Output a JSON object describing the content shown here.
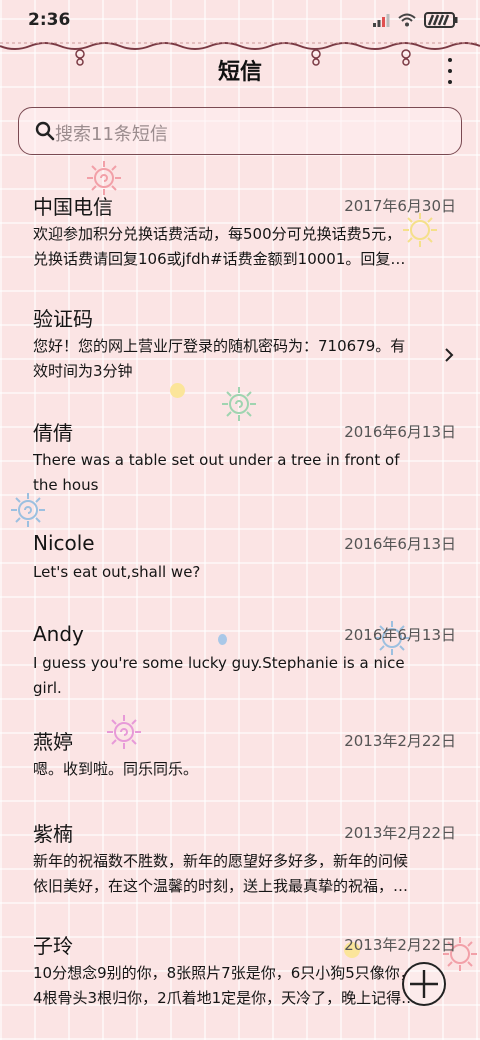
{
  "status": {
    "time": "2:36"
  },
  "header": {
    "title": "短信"
  },
  "search": {
    "placeholder": "搜索11条短信"
  },
  "messages": [
    {
      "sender": "中国电信",
      "date": "2017年6月30日",
      "lines": [
        "欢迎参加积分兑换话费活动，每500分可兑换话费5元，",
        "兑换话费请回复106或jfdh#话费金额到10001。回复…"
      ]
    },
    {
      "sender": "验证码",
      "date": "",
      "lines": [
        "您好！您的网上营业厅登录的随机密码为：710679。有",
        "效时间为3分钟"
      ]
    },
    {
      "sender": "倩倩",
      "date": "2016年6月13日",
      "lines": [
        "There was a table set out under a tree in front of",
        "the hous"
      ]
    },
    {
      "sender": "Nicole",
      "date": "2016年6月13日",
      "lines": [
        "Let's eat out,shall we?"
      ]
    },
    {
      "sender": "Andy",
      "date": "2016年6月13日",
      "lines": [
        "I guess you're some lucky guy.Stephanie is a nice",
        "girl."
      ]
    },
    {
      "sender": "燕婷",
      "date": "2013年2月22日",
      "lines": [
        "嗯。收到啦。同乐同乐。"
      ]
    },
    {
      "sender": "紫楠",
      "date": "2013年2月22日",
      "lines": [
        "新年的祝福数不胜数，新年的愿望好多好多，新年的问候",
        "依旧美好，在这个温馨的时刻，送上我最真挚的祝福，…"
      ]
    },
    {
      "sender": "子玲",
      "date": "2013年2月22日",
      "lines": [
        "10分想念9别的你，8张照片7张是你，6只小狗5只像你，",
        "4根骨头3根归你，2爪着地1定是你，天冷了，晚上记得…"
      ]
    }
  ],
  "colors": {
    "background": "#fbe4e4",
    "lace": "#7a3a44",
    "text": "#151515",
    "date": "#555555"
  },
  "icons": [
    "signal-icon",
    "wifi-icon",
    "battery-icon",
    "search-icon",
    "more-vert-icon",
    "chevron-right-icon",
    "compose-plus-icon"
  ]
}
